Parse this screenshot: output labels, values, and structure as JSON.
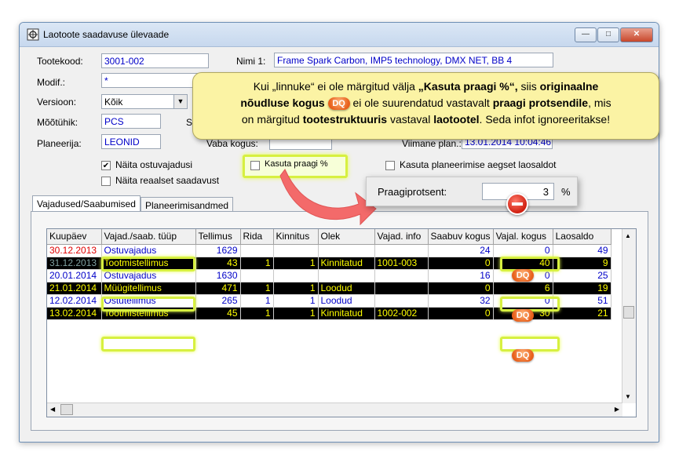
{
  "window": {
    "title": "Laotoote saadavuse ülevaade",
    "buttons": {
      "minimize": "—",
      "maximize": "□",
      "close": "✕"
    }
  },
  "form": {
    "tootekood_label": "Tootekood:",
    "tootekood_value": "3001-002",
    "nimi_label": "Nimi 1:",
    "nimi_value": "Frame Spark Carbon, IMP5 technology, DMX NET, BB 4",
    "modif_label": "Modif.:",
    "modif_value": "*",
    "versioon_label": "Versioon:",
    "versioon_value": "Kõik",
    "mootuhik_label": "Mõõtühik:",
    "mootuhik_value": "PCS",
    "s_label": "S",
    "planeerija_label": "Planeerija:",
    "planeerija_value": "LEONID",
    "vaba_kogus_label": "Vaba kogus:",
    "viimane_plan_label": "Viimane plan.:",
    "viimane_plan_value": "13.01.2014 10:04:46",
    "naita_ostuvajadusi": "Näita ostuvajadusi",
    "naita_reaalset": "Näita reaalset saadavust",
    "kasuta_praagi": "Kasuta praagi %",
    "kasuta_planeerimise": "Kasuta planeerimise aegset laosaldot"
  },
  "tabs": [
    "Vajadused/Saabumised",
    "Planeerimisandmed"
  ],
  "table": {
    "columns": [
      "Kuupäev",
      "Vajad./saab. tüüp",
      "Tellimus",
      "Rida",
      "Kinnitus",
      "Olek",
      "Vajad. info",
      "Saabuv kogus",
      "Vajal. kogus",
      "Laosaldo"
    ],
    "rows": [
      {
        "date": "30.12.2013",
        "type": "Ostuvajadus",
        "tellimus": "1629",
        "rida": "",
        "kinnitus": "",
        "olek": "",
        "info": "",
        "saabuv": "24",
        "vajal": "0",
        "laosaldo": "49",
        "style": "red"
      },
      {
        "date": "31.12.2013",
        "type": "Tootmistellimus",
        "tellimus": "43",
        "rida": "1",
        "kinnitus": "1",
        "olek": "Kinnitatud",
        "info": "1001-003",
        "saabuv": "0",
        "vajal": "40",
        "laosaldo": "9",
        "style": "black"
      },
      {
        "date": "20.01.2014",
        "type": "Ostuvajadus",
        "tellimus": "1630",
        "rida": "",
        "kinnitus": "",
        "olek": "",
        "info": "",
        "saabuv": "16",
        "vajal": "0",
        "laosaldo": "25",
        "style": "blue"
      },
      {
        "date": "21.01.2014",
        "type": "Müügitellimus",
        "tellimus": "471",
        "rida": "1",
        "kinnitus": "1",
        "olek": "Loodud",
        "info": "",
        "saabuv": "0",
        "vajal": "6",
        "laosaldo": "19",
        "style": "black"
      },
      {
        "date": "12.02.2014",
        "type": "Ostutellimus",
        "tellimus": "265",
        "rida": "1",
        "kinnitus": "1",
        "olek": "Loodud",
        "info": "",
        "saabuv": "32",
        "vajal": "0",
        "laosaldo": "51",
        "style": "blue"
      },
      {
        "date": "13.02.2014",
        "type": "Tootmistellimus",
        "tellimus": "45",
        "rida": "1",
        "kinnitus": "1",
        "olek": "Kinnitatud",
        "info": "1002-002",
        "saabuv": "0",
        "vajal": "30",
        "laosaldo": "21",
        "style": "black"
      }
    ]
  },
  "callout": {
    "l1_a": "Kui „linnuke“ ei ole märgitud välja ",
    "l1_b": "„Kasuta praagi %“,",
    "l1_c": " siis ",
    "l1_d": "originaalne",
    "l2_a": "nõudluse kogus",
    "l2_b": " ei ole suurendatud vastavalt ",
    "l2_c": "praagi protsendile",
    "l2_d": ", mis",
    "l3_a": "on märgitud ",
    "l3_b": "tootestruktuuris",
    "l3_c": " vastaval ",
    "l3_d": "laotootel",
    "l3_e": ". Seda infot ignoreeritakse!"
  },
  "dq_label": "DQ",
  "praagi": {
    "label": "Praagiprotsent:",
    "value": "3",
    "unit": "%"
  },
  "colors": {
    "accent_highlight": "#d7f040",
    "callout_bg": "#fbf3a4",
    "row_black": "#000000",
    "text_yellow": "#ffff00",
    "text_blue": "#0000c8",
    "text_red": "#e00000"
  },
  "icons": [
    "app-icon",
    "minimize-icon",
    "maximize-icon",
    "close-icon",
    "dq-badge-icon",
    "minus-icon"
  ]
}
